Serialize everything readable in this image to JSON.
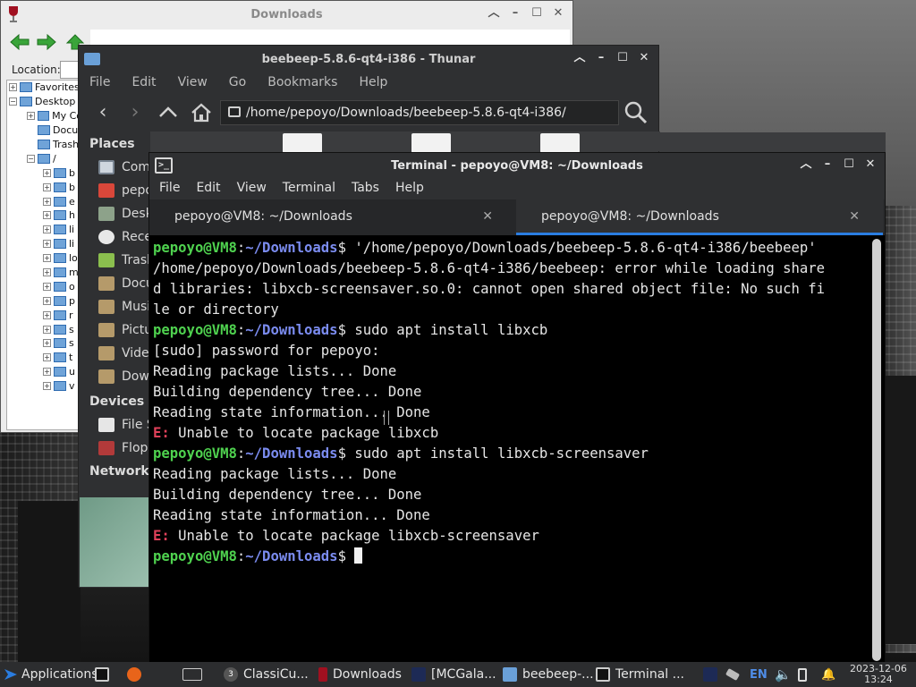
{
  "downloads_window": {
    "title": "Downloads",
    "location_label": "Location:",
    "tree": [
      "Favorites",
      "Desktop",
      "My Co",
      "Docu",
      "Trash",
      "/",
      "b",
      "b",
      "e",
      "h",
      "li",
      "li",
      "lo",
      "m",
      "o",
      "p",
      "r",
      "s",
      "s",
      "t",
      "u",
      "v"
    ]
  },
  "thunar": {
    "title": "beebeep-5.8.6-qt4-i386 - Thunar",
    "menu": [
      "File",
      "Edit",
      "View",
      "Go",
      "Bookmarks",
      "Help"
    ],
    "path": "/home/pepoyo/Downloads/beebeep-5.8.6-qt4-i386/",
    "places_heading": "Places",
    "places": [
      "Com",
      "pepo",
      "Desk",
      "Rece",
      "Trash",
      "Docu",
      "Musi",
      "Pictu",
      "Vide",
      "Dow"
    ],
    "devices_heading": "Devices",
    "devices": [
      "File S",
      "Flop"
    ],
    "network_heading": "Network"
  },
  "terminal": {
    "title": "Terminal - pepoyo@VM8: ~/Downloads",
    "menu": [
      "File",
      "Edit",
      "View",
      "Terminal",
      "Tabs",
      "Help"
    ],
    "tabs": [
      {
        "label": "pepoyo@VM8: ~/Downloads"
      },
      {
        "label": "pepoyo@VM8: ~/Downloads"
      }
    ],
    "prompt_user": "pepoyo@VM8",
    "prompt_sep": ":",
    "prompt_path": "~/Downloads",
    "prompt_end": "$ ",
    "cmd1": "'/home/pepoyo/Downloads/beebeep-5.8.6-qt4-i386/beebeep'",
    "out1a": "/home/pepoyo/Downloads/beebeep-5.8.6-qt4-i386/beebeep: error while loading share",
    "out1b": "d libraries: libxcb-screensaver.so.0: cannot open shared object file: No such fi",
    "out1c": "le or directory",
    "cmd2": "sudo apt install libxcb",
    "out2a": "[sudo] password for pepoyo:",
    "out2b": "Reading package lists... Done",
    "out2c": "Building dependency tree... Done",
    "out2d": "Reading state information... Done",
    "err_tag": "E:",
    "err2": " Unable to locate package libxcb",
    "cmd3": "sudo apt install libxcb-screensaver",
    "out3a": "Reading package lists... Done",
    "out3b": "Building dependency tree... Done",
    "out3c": "Reading state information... Done",
    "err3": " Unable to locate package libxcb-screensaver"
  },
  "taskbar": {
    "applications": "Applications",
    "items": [
      "ClassiCu...",
      "Downloads",
      "[MCGala...",
      "beebeep-...",
      "Terminal ..."
    ],
    "badge": "3",
    "language": "EN",
    "date": "2023-12-06",
    "time": "13:24"
  },
  "colors": {
    "prompt_user": "#4fd24f",
    "prompt_path": "#7b8cf0",
    "error": "#e0415a",
    "tab_accent": "#2a7de1"
  }
}
